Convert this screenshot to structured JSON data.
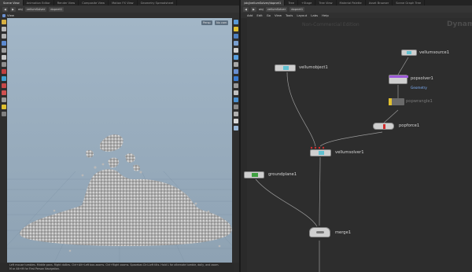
{
  "left_panel": {
    "tabs": [
      {
        "label": "Scene View",
        "active": true
      },
      {
        "label": "Animation Editor",
        "active": false
      },
      {
        "label": "Render View",
        "active": false
      },
      {
        "label": "Composite View",
        "active": false
      },
      {
        "label": "Motion FX View",
        "active": false
      },
      {
        "label": "Geometry Spreadsheet",
        "active": false
      }
    ],
    "path": {
      "obj": "obj",
      "node1": "vellumSolver",
      "node2": "dopnet1"
    },
    "view_label": "View",
    "persp_menu": "Persp",
    "cam_menu": "No cam",
    "status_line1": "Left mouse tumbles. Middle pans. Right dollies. Ctrl+Alt+Left box-zooms. Ctrl+Right zooms. Spacebar-Ctrl-Left tilts. Hold L for alternate tumble, dolly, and zoom.",
    "status_line2": "M or Alt+M for First Person Navigation."
  },
  "right_panel": {
    "tabs": [
      {
        "label": "/obj/vellumSolver/dopnet1",
        "active": true
      },
      {
        "label": "Tree",
        "active": false
      },
      {
        "label": "+Stage",
        "active": false
      },
      {
        "label": "Tree View",
        "active": false
      },
      {
        "label": "Material Palette",
        "active": false
      },
      {
        "label": "Asset Browser",
        "active": false
      },
      {
        "label": "Scene Graph Tree",
        "active": false
      }
    ],
    "path": {
      "obj": "obj",
      "node1": "vellumSolver",
      "node2": "dopnet1"
    },
    "menu": [
      "Add",
      "Edit",
      "Go",
      "View",
      "Tools",
      "Layout",
      "Labs",
      "Help"
    ],
    "context_title": "Non-Commercial Edition",
    "context_name": "Dynamics"
  },
  "nodes": {
    "vellumsource1": "vellumsource1",
    "vellumobject1": "vellumobject1",
    "popsolver1": "popsolver1",
    "popsolver1_sub": "Geometry",
    "popwrangle1": "popwrangle1",
    "popforce1": "popforce1",
    "vellumsolver1": "vellumsolver1",
    "groundplane1": "groundplane1",
    "merge1": "merge1"
  },
  "colors": {
    "viewport_top": "#9fb3c4",
    "viewport_bottom": "#8ea2b3",
    "network_bg": "#2d2d2d",
    "wire": "#9a9a9a",
    "popsolver_accent": "#9b59d6",
    "popwrangle_accent": "#e0c030",
    "groundplane_accent": "#3fa040",
    "popforce_accent": "#d02a2a"
  }
}
